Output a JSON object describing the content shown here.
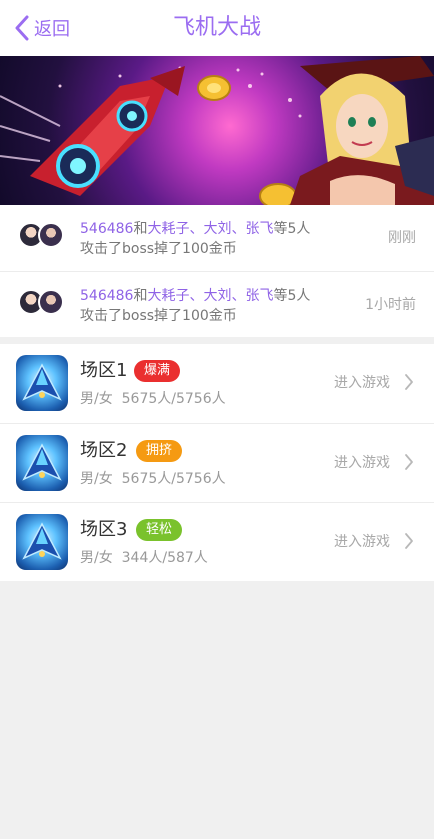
{
  "nav": {
    "back_label": "返回",
    "title": "飞机大战"
  },
  "activity": [
    {
      "user_id": "546486",
      "and": "和",
      "names": "大耗子、大刘、张飞",
      "etc": "等5人",
      "line2": "攻击了boss掉了100金币",
      "time": "刚刚"
    },
    {
      "user_id": "546486",
      "and": "和",
      "names": "大耗子、大刘、张飞",
      "etc": "等5人",
      "line2": "攻击了boss掉了100金币",
      "time": "1小时前"
    }
  ],
  "zones": [
    {
      "name": "场区1",
      "badge": "爆满",
      "badge_color": "#ea2f2f",
      "count_label": "男/女",
      "count": "5675人/5756人",
      "enter_label": "进入游戏"
    },
    {
      "name": "场区2",
      "badge": "拥挤",
      "badge_color": "#f59a12",
      "count_label": "男/女",
      "count": "5675人/5756人",
      "enter_label": "进入游戏"
    },
    {
      "name": "场区3",
      "badge": "轻松",
      "badge_color": "#7ac22c",
      "count_label": "男/女",
      "count": "344人/587人",
      "enter_label": "进入游戏"
    }
  ],
  "colors": {
    "accent": "#9b6df1",
    "background": "#f0f0f0"
  }
}
